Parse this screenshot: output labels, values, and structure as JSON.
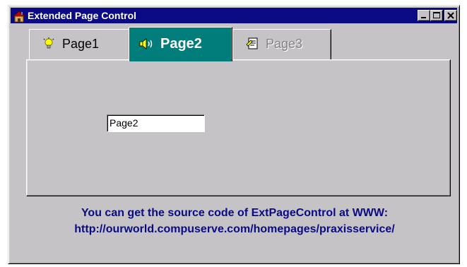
{
  "window": {
    "title": "Extended Page Control",
    "controls": {
      "minimize_icon": "minimize-icon",
      "maximize_icon": "maximize-icon",
      "close_icon": "close-icon"
    }
  },
  "tabs": [
    {
      "label": "Page1",
      "icon": "lightbulb-icon",
      "state": "normal"
    },
    {
      "label": "Page2",
      "icon": "speaker-icon",
      "state": "active"
    },
    {
      "label": "Page3",
      "icon": "document-icon",
      "state": "disabled"
    }
  ],
  "page": {
    "edit_value": "Page2"
  },
  "info": {
    "line1": "You can get the source code of ExtPageControl at WWW:",
    "line2": "http://ourworld.compuserve.com/homepages/praxisservice/"
  },
  "colors": {
    "titlebar": "#0a0a84",
    "active_tab": "#007d7b",
    "face": "#c6c3c6",
    "info_text": "#0a0a84"
  }
}
